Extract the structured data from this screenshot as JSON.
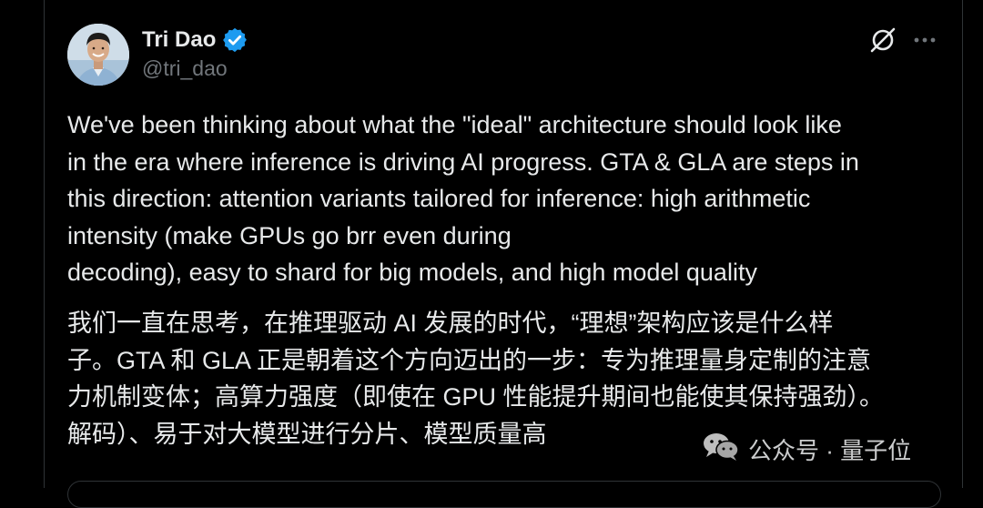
{
  "tweet": {
    "author": {
      "display_name": "Tri Dao",
      "handle": "@tri_dao",
      "verified": true,
      "verified_icon": "verified-badge-icon",
      "avatar_icon": "avatar-photo"
    },
    "actions": {
      "grok_icon": "grok-slash-icon",
      "more_icon": "more-dots-icon"
    },
    "text_en": [
      "We've been thinking about what the \"ideal\" architecture should look like",
      "in the era where inference is driving AI progress. GTA & GLA are steps in",
      "this direction: attention variants tailored for inference: high arithmetic",
      "intensity (make GPUs go brr even during",
      "decoding), easy to shard for big models, and high model quality"
    ],
    "text_zh": [
      "我们一直在思考，在推理驱动 AI 发展的时代，“理想”架构应该是什么样",
      "子。GTA 和 GLA 正是朝着这个方向迈出的一步：专为推理量身定制的注意",
      "力机制变体；高算力强度（即使在 GPU 性能提升期间也能使其保持强劲）。",
      "解码）、易于对大模型进行分片、模型质量高"
    ]
  },
  "watermark": {
    "icon": "wechat-icon",
    "text": "公众号 · 量子位"
  },
  "colors": {
    "background": "#000000",
    "text_primary": "#e7e9ea",
    "text_secondary": "#71767b",
    "verified_blue": "#1d9bf0",
    "border": "#2f3336"
  }
}
